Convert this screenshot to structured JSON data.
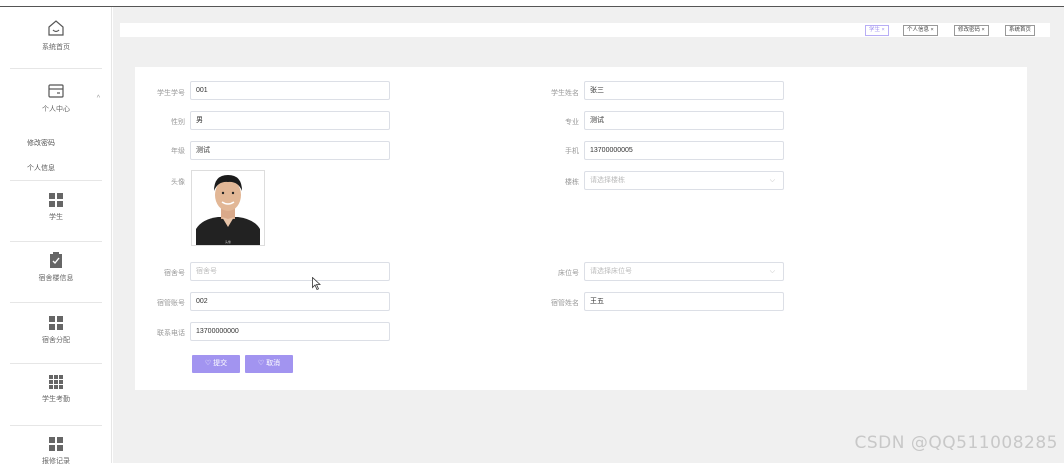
{
  "sidebar": {
    "home_label": "系统首页",
    "personal_label": "个人中心",
    "sub_items": [
      "修改密码",
      "个人信息"
    ],
    "items": [
      {
        "label": "学生"
      },
      {
        "label": "宿舍楼信息"
      },
      {
        "label": "宿舍分配"
      },
      {
        "label": "学生考勤"
      },
      {
        "label": "报修记录"
      }
    ]
  },
  "tabs": [
    {
      "label": "学生 ×",
      "active": true
    },
    {
      "label": "个人信息 ×",
      "active": false
    },
    {
      "label": "修改密码 ×",
      "active": false
    },
    {
      "label": "系统首页",
      "active": false
    }
  ],
  "form": {
    "student_no": {
      "label": "学生学号",
      "value": "001"
    },
    "student_name": {
      "label": "学生姓名",
      "value": "张三"
    },
    "gender": {
      "label": "性别",
      "value": "男"
    },
    "major": {
      "label": "专业",
      "value": "测试"
    },
    "grade": {
      "label": "年级",
      "value": "测试"
    },
    "phone": {
      "label": "手机",
      "value": "13700000005"
    },
    "avatar": {
      "label": "头像",
      "caption": "头像"
    },
    "building": {
      "label": "楼栋",
      "placeholder": "请选择楼栋"
    },
    "dorm_no": {
      "label": "宿舍号",
      "placeholder": "宿舍号"
    },
    "bed_no": {
      "label": "床位号",
      "placeholder": "请选择床位号"
    },
    "manager_account": {
      "label": "宿管账号",
      "value": "002"
    },
    "manager_name": {
      "label": "宿管姓名",
      "value": "王五"
    },
    "contact_phone": {
      "label": "联系电话",
      "value": "13700000000"
    },
    "submit_label": "♡ 提交",
    "cancel_label": "♡ 取消"
  },
  "watermark": "CSDN @QQ511008285",
  "colors": {
    "accent": "#a294f0",
    "background": "#f0f0f0"
  }
}
